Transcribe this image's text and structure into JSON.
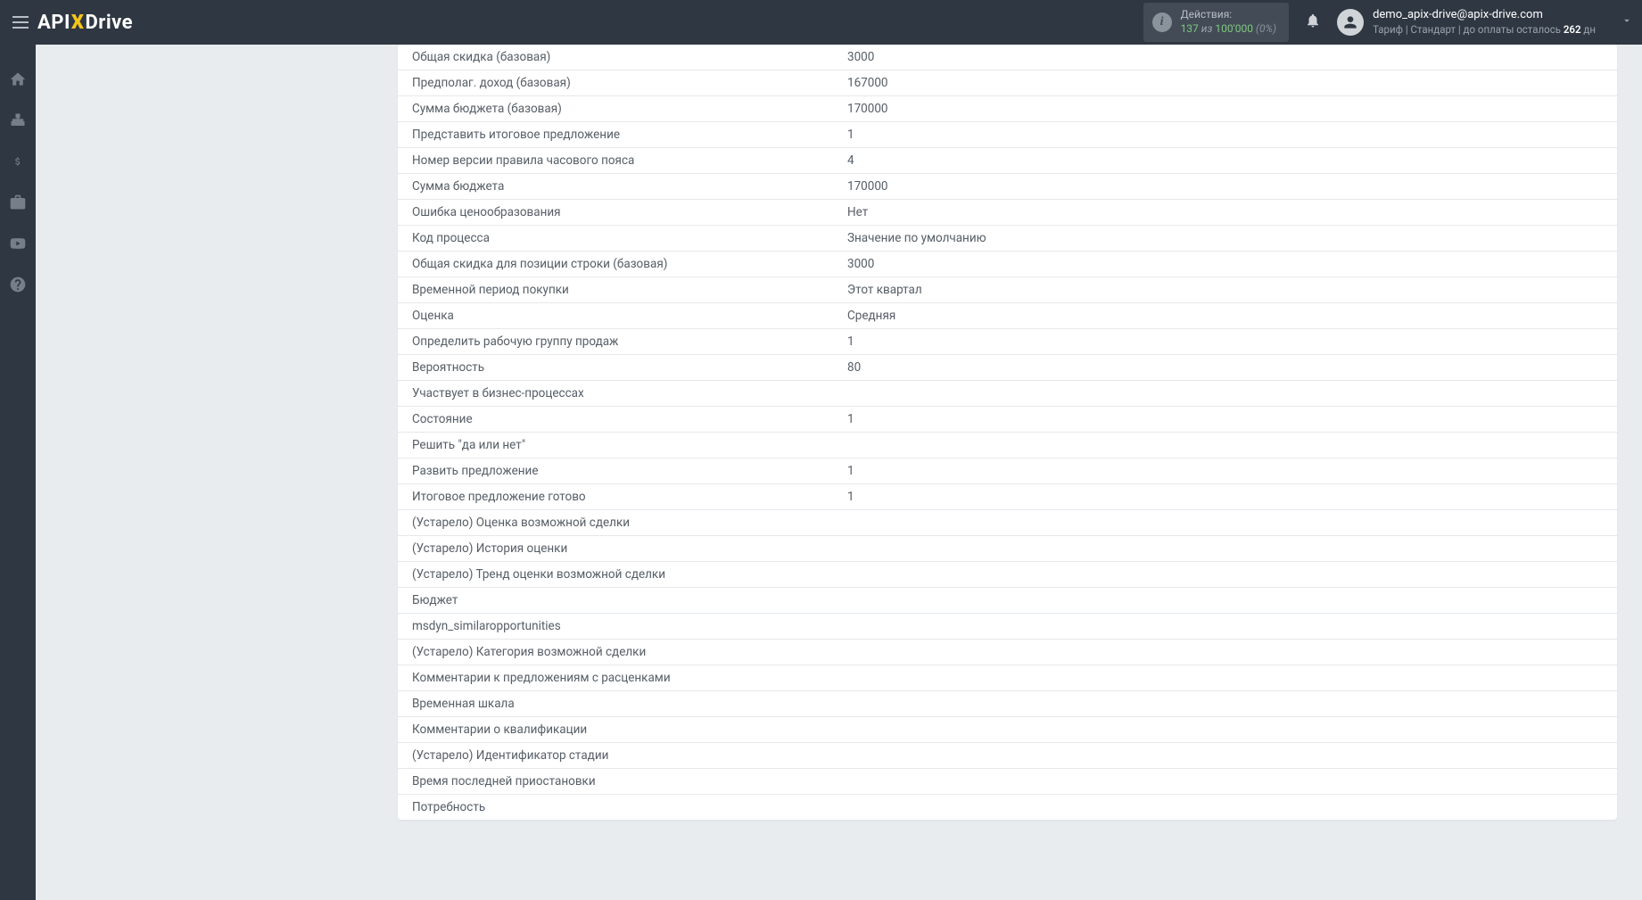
{
  "header": {
    "logo_api": "API",
    "logo_x": "X",
    "logo_drive": "Drive",
    "actions_label": "Действия:",
    "actions_count": "137",
    "actions_iz": "из",
    "actions_total": "100'000",
    "actions_pct": "(0%)",
    "user_email": "demo_apix-drive@apix-drive.com",
    "tariff_prefix": "Тариф | Стандарт | до оплаты осталось ",
    "tariff_days": "262",
    "tariff_suffix": " дн"
  },
  "fields": [
    {
      "label": "Общая скидка (базовая)",
      "value": "3000"
    },
    {
      "label": "Предполаг. доход (базовая)",
      "value": "167000"
    },
    {
      "label": "Сумма бюджета (базовая)",
      "value": "170000"
    },
    {
      "label": "Представить итоговое предложение",
      "value": "1"
    },
    {
      "label": "Номер версии правила часового пояса",
      "value": "4"
    },
    {
      "label": "Сумма бюджета",
      "value": "170000"
    },
    {
      "label": "Ошибка ценообразования",
      "value": "Нет"
    },
    {
      "label": "Код процесса",
      "value": "Значение по умолчанию"
    },
    {
      "label": "Общая скидка для позиции строки (базовая)",
      "value": "3000"
    },
    {
      "label": "Временной период покупки",
      "value": "Этот квартал"
    },
    {
      "label": "Оценка",
      "value": "Средняя"
    },
    {
      "label": "Определить рабочую группу продаж",
      "value": "1"
    },
    {
      "label": "Вероятность",
      "value": "80"
    },
    {
      "label": "Участвует в бизнес-процессах",
      "value": ""
    },
    {
      "label": "Состояние",
      "value": "1"
    },
    {
      "label": "Решить \"да или нет\"",
      "value": ""
    },
    {
      "label": "Развить предложение",
      "value": "1"
    },
    {
      "label": "Итоговое предложение готово",
      "value": "1"
    },
    {
      "label": "(Устарело) Оценка возможной сделки",
      "value": ""
    },
    {
      "label": "(Устарело) История оценки",
      "value": ""
    },
    {
      "label": "(Устарело) Тренд оценки возможной сделки",
      "value": ""
    },
    {
      "label": "Бюджет",
      "value": ""
    },
    {
      "label": "msdyn_similaropportunities",
      "value": ""
    },
    {
      "label": "(Устарело) Категория возможной сделки",
      "value": ""
    },
    {
      "label": "Комментарии к предложениям с расценками",
      "value": ""
    },
    {
      "label": "Временная шкала",
      "value": ""
    },
    {
      "label": "Комментарии о квалификации",
      "value": ""
    },
    {
      "label": "(Устарело) Идентификатор стадии",
      "value": ""
    },
    {
      "label": "Время последней приостановки",
      "value": ""
    },
    {
      "label": "Потребность",
      "value": ""
    }
  ]
}
